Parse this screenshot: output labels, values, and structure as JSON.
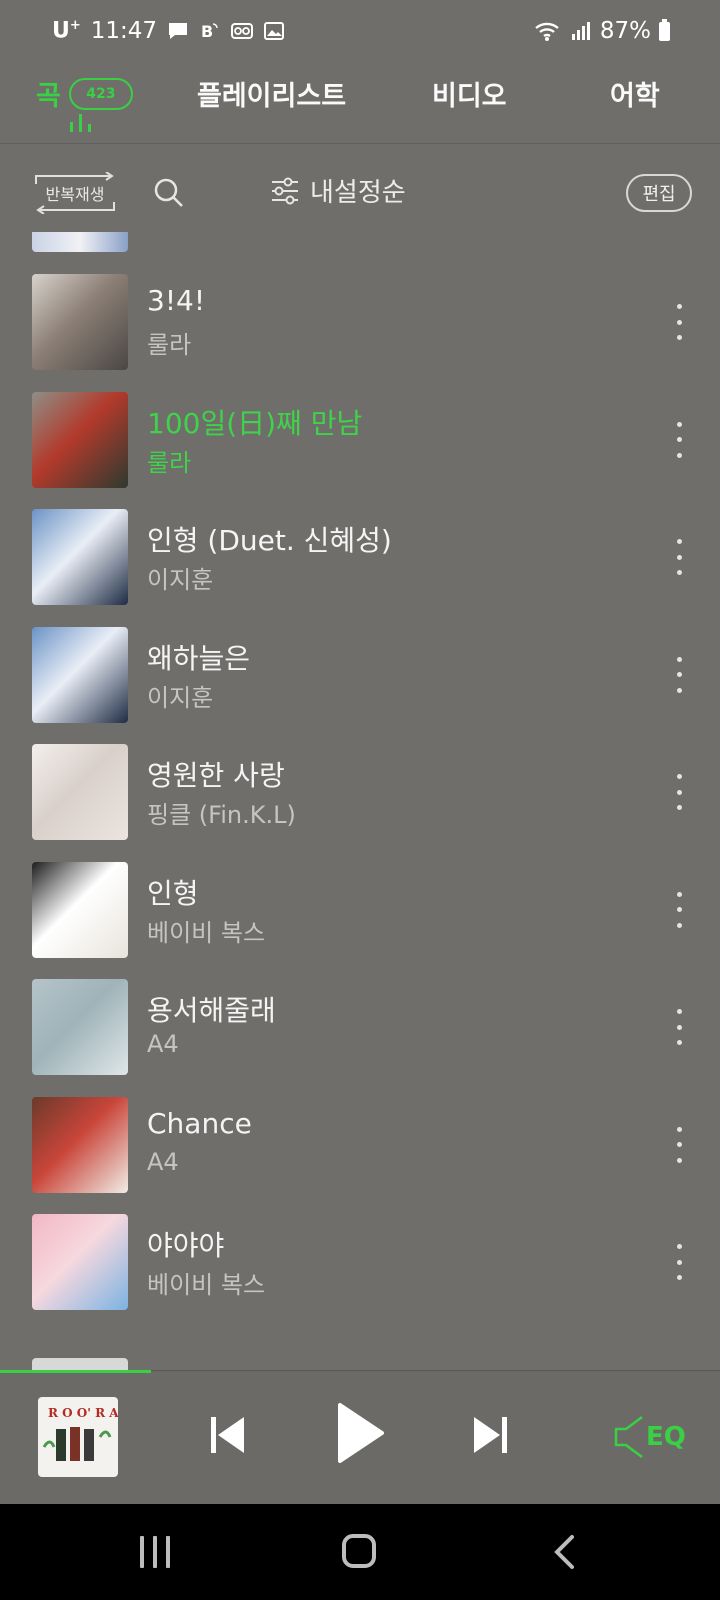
{
  "status_bar": {
    "carrier": "U",
    "carrier_sup": "+",
    "time": "11:47",
    "battery": "87%",
    "icons": [
      "chat-icon",
      "bixby-icon",
      "voicemail-icon",
      "image-icon",
      "wifi-icon",
      "signal-icon",
      "battery-icon"
    ]
  },
  "tabs": {
    "songs": "곡",
    "songs_count": "423",
    "playlist": "플레이리스트",
    "video": "비디오",
    "language": "어학"
  },
  "toolbar": {
    "repeat": "반복재생",
    "sort": "내설정순",
    "edit": "편집"
  },
  "songs": [
    {
      "title": "3!4!",
      "artist": "룰라",
      "art_colors": [
        "#d7d2cc",
        "#4a4744",
        "#8c7f76"
      ]
    },
    {
      "title": "100일(日)째 만남",
      "artist": "룰라",
      "playing": true,
      "art_colors": [
        "#8e8f87",
        "#2e3a2f",
        "#b23a2c"
      ]
    },
    {
      "title": "인형 (Duet. 신혜성)",
      "artist": "이지훈",
      "art_colors": [
        "#6b93c6",
        "#1e2c44",
        "#e9eef6"
      ]
    },
    {
      "title": "왜하늘은",
      "artist": "이지훈",
      "art_colors": [
        "#6b93c6",
        "#1e2c44",
        "#e9eef6"
      ]
    },
    {
      "title": "영원한 사랑",
      "artist": "핑클 (Fin.K.L)",
      "art_colors": [
        "#f3efec",
        "#ece4df",
        "#d9d0ca"
      ]
    },
    {
      "title": "인형",
      "artist": "베이비 복스",
      "art_colors": [
        "#1d1d1d",
        "#e8e4dc",
        "#ffffff"
      ]
    },
    {
      "title": "용서해줄래",
      "artist": "A4",
      "art_colors": [
        "#b5c4c9",
        "#dfe6e8",
        "#9fb3b9"
      ]
    },
    {
      "title": "Chance",
      "artist": "A4",
      "art_colors": [
        "#6b3a2a",
        "#f0ede6",
        "#c9453a"
      ]
    },
    {
      "title": "야야야",
      "artist": "베이비 복스",
      "art_colors": [
        "#f2b7c4",
        "#7bb3e2",
        "#f7d8df"
      ]
    }
  ],
  "player": {
    "progress_fraction": 0.21
  },
  "accent_color": "#39d043",
  "nav": {
    "icons": [
      "recent-apps-icon",
      "home-icon",
      "back-icon"
    ]
  }
}
